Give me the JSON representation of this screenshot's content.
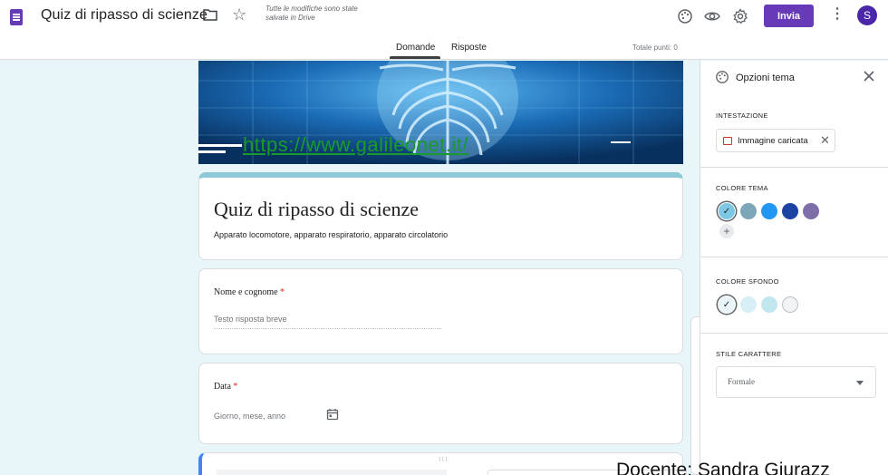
{
  "header": {
    "doc_title": "Quiz di ripasso di scienze",
    "saved_note": "Tutte le modifiche sono state salvate in Drive",
    "send_label": "Invia",
    "avatar_letter": "S",
    "brand_color": "#673ab7",
    "icons": [
      "forms-icon",
      "folder-icon",
      "star-icon",
      "palette-icon",
      "preview-icon",
      "settings-icon",
      "more-vert-icon"
    ]
  },
  "tabs": [
    {
      "label": "Domande",
      "active": true
    },
    {
      "label": "Risposte",
      "active": false
    }
  ],
  "total_points": "Totale punti: 0",
  "banner": {
    "link_text": "https://www.galileonet.it/"
  },
  "form": {
    "title": "Quiz di ripasso di scienze",
    "description": "Apparato locomotore, apparato respiratorio, apparato circolatorio",
    "questions": [
      {
        "label": "Nome e cognome",
        "required_mark": "*",
        "placeholder": "Testo risposta breve"
      },
      {
        "label": "Data",
        "required_mark": "*",
        "placeholder": "Giorno, mese, anno"
      }
    ]
  },
  "theme_panel": {
    "title": "Opzioni tema",
    "header_section": "INTESTAZIONE",
    "uploaded_chip": "Immagine caricata",
    "theme_color_section": "COLORE TEMA",
    "theme_colors": [
      "#7ec8e3",
      "#7ba7b8",
      "#2196f3",
      "#1e44a3",
      "#7e6fa8"
    ],
    "selected_theme_color": "#7ec8e3",
    "bg_color_section": "COLORE SFONDO",
    "bg_colors": [
      "#e8f5f9",
      "#d6eef6",
      "#c2e6f0",
      "#f1f3f4"
    ],
    "selected_bg_color": "#e8f5f9",
    "font_section": "STILE CARATTERE",
    "font_value": "Formale"
  },
  "footer_credit": "Docente: Sandra Giurazz"
}
